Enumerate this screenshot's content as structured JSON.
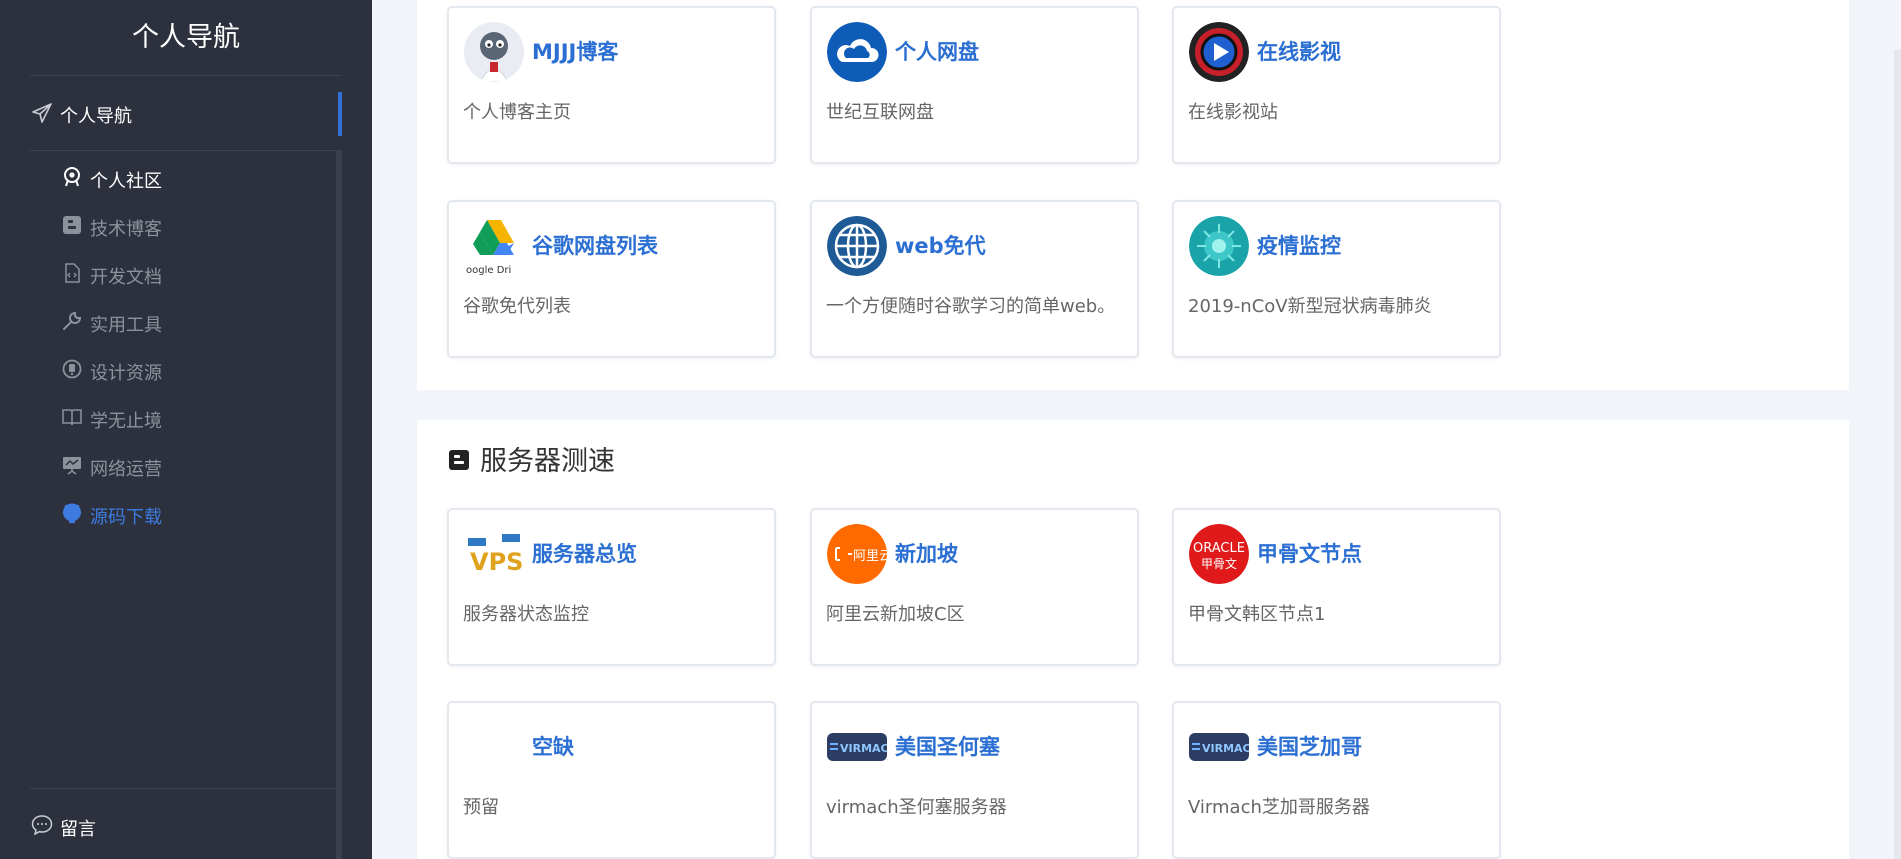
{
  "sidebar": {
    "brand": "个人导航",
    "main_item": {
      "label": "个人导航",
      "icon": "paper-plane-icon"
    },
    "items": [
      {
        "label": "个人社区",
        "icon": "community-icon",
        "state": "selected"
      },
      {
        "label": "技术博客",
        "icon": "blogger-icon",
        "state": "normal"
      },
      {
        "label": "开发文档",
        "icon": "code-file-icon",
        "state": "normal"
      },
      {
        "label": "实用工具",
        "icon": "wrench-icon",
        "state": "normal"
      },
      {
        "label": "设计资源",
        "icon": "design-icon",
        "state": "normal"
      },
      {
        "label": "学无止境",
        "icon": "book-icon",
        "state": "normal"
      },
      {
        "label": "网络运营",
        "icon": "presentation-icon",
        "state": "normal"
      },
      {
        "label": "源码下载",
        "icon": "github-icon",
        "state": "link"
      }
    ],
    "footer_item": {
      "label": "留言",
      "icon": "comment-icon"
    }
  },
  "top_cards": [
    {
      "title": "MJJJ博客",
      "desc": "个人博客主页",
      "icon": "cartoon-avatar-icon"
    },
    {
      "title": "个人网盘",
      "desc": "世纪互联网盘",
      "icon": "cloud-icon"
    },
    {
      "title": "在线影视",
      "desc": "在线影视站",
      "icon": "play-icon"
    },
    {
      "title": "谷歌网盘列表",
      "desc": "谷歌免代列表",
      "icon": "google-drive-icon",
      "logo_text": "oogle Dri"
    },
    {
      "title": "web免代",
      "desc": "一个方便随时谷歌学习的简单web。",
      "icon": "globe-icon"
    },
    {
      "title": "疫情监控",
      "desc": "2019-nCoV新型冠状病毒肺炎",
      "icon": "virus-icon"
    }
  ],
  "section": {
    "title": "服务器测速",
    "icon": "blogger-icon"
  },
  "server_cards": [
    {
      "title": "服务器总览",
      "desc": "服务器状态监控",
      "icon": "vps-icon",
      "logo_text": "VPS"
    },
    {
      "title": "新加坡",
      "desc": "阿里云新加坡C区",
      "icon": "aliyun-icon",
      "logo_text": "阿里云"
    },
    {
      "title": "甲骨文节点",
      "desc": "甲骨文韩区节点1",
      "icon": "oracle-icon",
      "logo_text": "ORACLE 甲骨文"
    },
    {
      "title": "空缺",
      "desc": "预留",
      "icon": "blank-icon"
    },
    {
      "title": "美国圣何塞",
      "desc": "virmach圣何塞服务器",
      "icon": "virmach-icon",
      "logo_text": "VIRMACH"
    },
    {
      "title": "美国芝加哥",
      "desc": "Virmach芝加哥服务器",
      "icon": "virmach-icon",
      "logo_text": "VIRMACH"
    }
  ],
  "colors": {
    "sidebar_bg": "#2c313d",
    "accent": "#2f6fd6",
    "card_title": "#2b6fd3",
    "link": "#3e7be0"
  }
}
